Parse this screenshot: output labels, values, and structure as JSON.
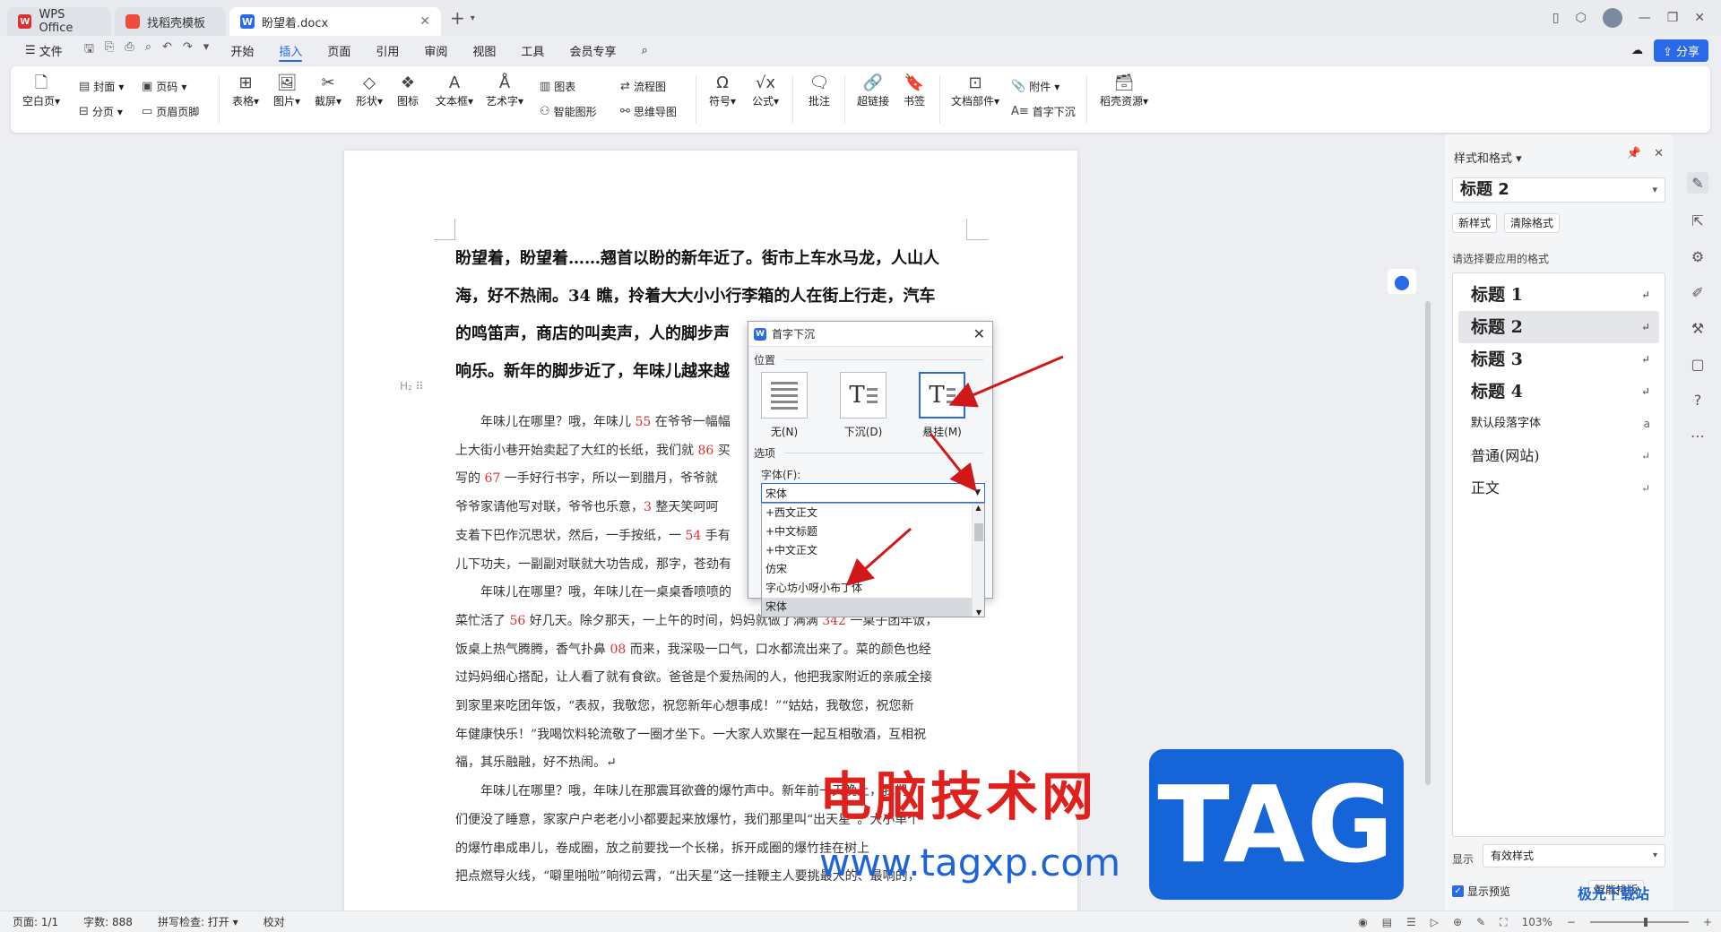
{
  "tabs": [
    {
      "label": "WPS Office",
      "icon": "wps-logo-icon"
    },
    {
      "label": "找稻壳模板",
      "icon": "template-icon"
    },
    {
      "label": "盼望着.docx",
      "icon": "word-doc-icon"
    }
  ],
  "menu": {
    "file": "文件",
    "items": [
      "开始",
      "插入",
      "页面",
      "引用",
      "审阅",
      "视图",
      "工具",
      "会员专享"
    ],
    "active": "插入",
    "share": "分享"
  },
  "ribbon": {
    "blank_page": "空白页",
    "cover": "封面",
    "page_break": "分页",
    "page_number": "页码",
    "header_footer": "页眉页脚",
    "table": "表格",
    "picture": "图片",
    "screenshot": "截屏",
    "shape": "形状",
    "icon": "图标",
    "textbox": "文本框",
    "wordart": "艺术字",
    "chart": "图表",
    "smart_graphic": "智能图形",
    "flowchart": "流程图",
    "mindmap": "思维导图",
    "symbol": "符号",
    "formula": "公式",
    "comment": "批注",
    "hyperlink": "超链接",
    "bookmark": "书签",
    "doc_parts": "文档部件",
    "attachment": "附件",
    "drop_cap": "首字下沉",
    "docer_resources": "稻壳资源"
  },
  "document": {
    "heading_lines": [
      "盼望着，盼望着……翘首以盼的新年近了。街市上车水马龙，人山人",
      "海，好不热闹。34 瞧，拎着大大小小行李箱的人在街上行走，汽车",
      "的鸣笛声，商店的叫卖声，人的脚步声",
      "响乐。新年的脚步近了，年味儿越来越"
    ],
    "h2_marker": "H₂ ⠿",
    "body_lines": [
      {
        "pre": "　　年味儿在哪里？哦，年味儿 ",
        "num": "55",
        "post": " 在爷爷一幅幅"
      },
      {
        "pre": "上大街小巷开始卖起了大红的长纸，我们就 ",
        "num": "86",
        "post": " 买"
      },
      {
        "pre": "写的 ",
        "num": "67",
        "post": " 一手好行书字，所以一到腊月，爷爷就"
      },
      {
        "pre": "爷爷家请他写对联，爷爷也乐意，",
        "num": "3",
        "post": " 整天笑呵呵"
      },
      {
        "pre": "支着下巴作沉思状，然后，一手按纸，一 ",
        "num": "54",
        "post": " 手有"
      },
      {
        "pre": "儿下功夫，一副副对联就大功告成，那字，苍劲有",
        "num": "",
        "post": ""
      },
      {
        "pre": "　　年味儿在哪里？哦，年味儿在一桌桌香喷喷的",
        "num": "",
        "post": ""
      },
      {
        "pre": "菜忙活了 ",
        "num": "56",
        "post": " 好几天。除夕那天，一上午的时间，妈妈就做了满满 "
      },
      {
        "pre": "饭桌上热气腾腾，香气扑鼻 ",
        "num": "08",
        "post": " 而来，我深吸一口气，口水都流出来了。菜的颜色也经"
      },
      {
        "pre": "过妈妈细心搭配，让人看了就有食欲。爸爸是个爱热闹的人，他把我家附近的亲戚全接",
        "num": "",
        "post": ""
      },
      {
        "pre": "到家里来吃团年饭，“表叔，我敬您，祝您新年心想事成！”“姑姑，我敬您，祝您新",
        "num": "",
        "post": ""
      },
      {
        "pre": "年健康快乐！”我喝饮料轮流敬了一圈才坐下。一大家人欢聚在一起互相敬酒，互相祝",
        "num": "",
        "post": ""
      },
      {
        "pre": "福，其乐融融，好不热闹。↵",
        "num": "",
        "post": ""
      },
      {
        "pre": "　　年味儿在哪里？哦，年味儿在那震耳欲聋的爆竹声中。新年前一天晚上，我们",
        "num": "",
        "post": ""
      },
      {
        "pre": "们便没了睡意，家家户户老老小小都要起来放爆竹，我们那里叫“出天星”。大小单个",
        "num": "",
        "post": ""
      },
      {
        "pre": "的爆竹串成串儿，卷成圈，放之前要找一个长梯，拆开成圈的爆竹挂在树上",
        "num": "",
        "post": ""
      },
      {
        "pre": "把点燃导火线，“噼里啪啦”响彻云霄，“出天星”这一挂鞭主人要挑最大的、最响的，",
        "num": "",
        "post": ""
      }
    ],
    "line8_extra_num": "342",
    "line8_extra_post": " 一桌子团年饭，"
  },
  "dialog": {
    "title": "首字下沉",
    "position_label": "位置",
    "options": [
      {
        "label": "无(N)",
        "icon": "no-dropcap-icon"
      },
      {
        "label": "下沉(D)",
        "icon": "dropped-icon"
      },
      {
        "label": "悬挂(M)",
        "icon": "in-margin-icon"
      }
    ],
    "selected_option": "悬挂(M)",
    "options_label": "选项",
    "font_label": "字体(F):",
    "font_value": "宋体",
    "font_list": [
      "+西文正文",
      "+中文标题",
      "+中文正文",
      "仿宋",
      "字心坊小呀小布丁体",
      "宋体"
    ],
    "font_selected": "宋体"
  },
  "styles_panel": {
    "title": "样式和格式",
    "current_style": "标题  2",
    "new_style": "新样式",
    "clear_format": "清除格式",
    "choose_label": "请选择要应用的格式",
    "styles": [
      {
        "name": "标题  1",
        "kind": "h",
        "mark": "↵"
      },
      {
        "name": "标题  2",
        "kind": "h",
        "mark": "↵"
      },
      {
        "name": "标题  3",
        "kind": "h",
        "mark": "↵"
      },
      {
        "name": "标题  4",
        "kind": "h",
        "mark": "↵"
      },
      {
        "name": "默认段落字体",
        "kind": "s",
        "mark": "a"
      },
      {
        "name": "普通(网站)",
        "kind": "n",
        "mark": "↵"
      },
      {
        "name": "正文",
        "kind": "n",
        "mark": "↵"
      }
    ],
    "selected_style": "标题  2",
    "show_label": "显示",
    "show_value": "有效样式",
    "preview_label": "显示预览",
    "smart_layout": "智能排版"
  },
  "statusbar": {
    "page": "页面: 1/1",
    "words": "字数: 888",
    "spell": "拼写检查: 打开",
    "proof": "校对",
    "zoom": "103%"
  },
  "colors": {
    "accent": "#2a6ae8",
    "number_red": "#e02d2d",
    "arrow_red": "#d01818"
  }
}
